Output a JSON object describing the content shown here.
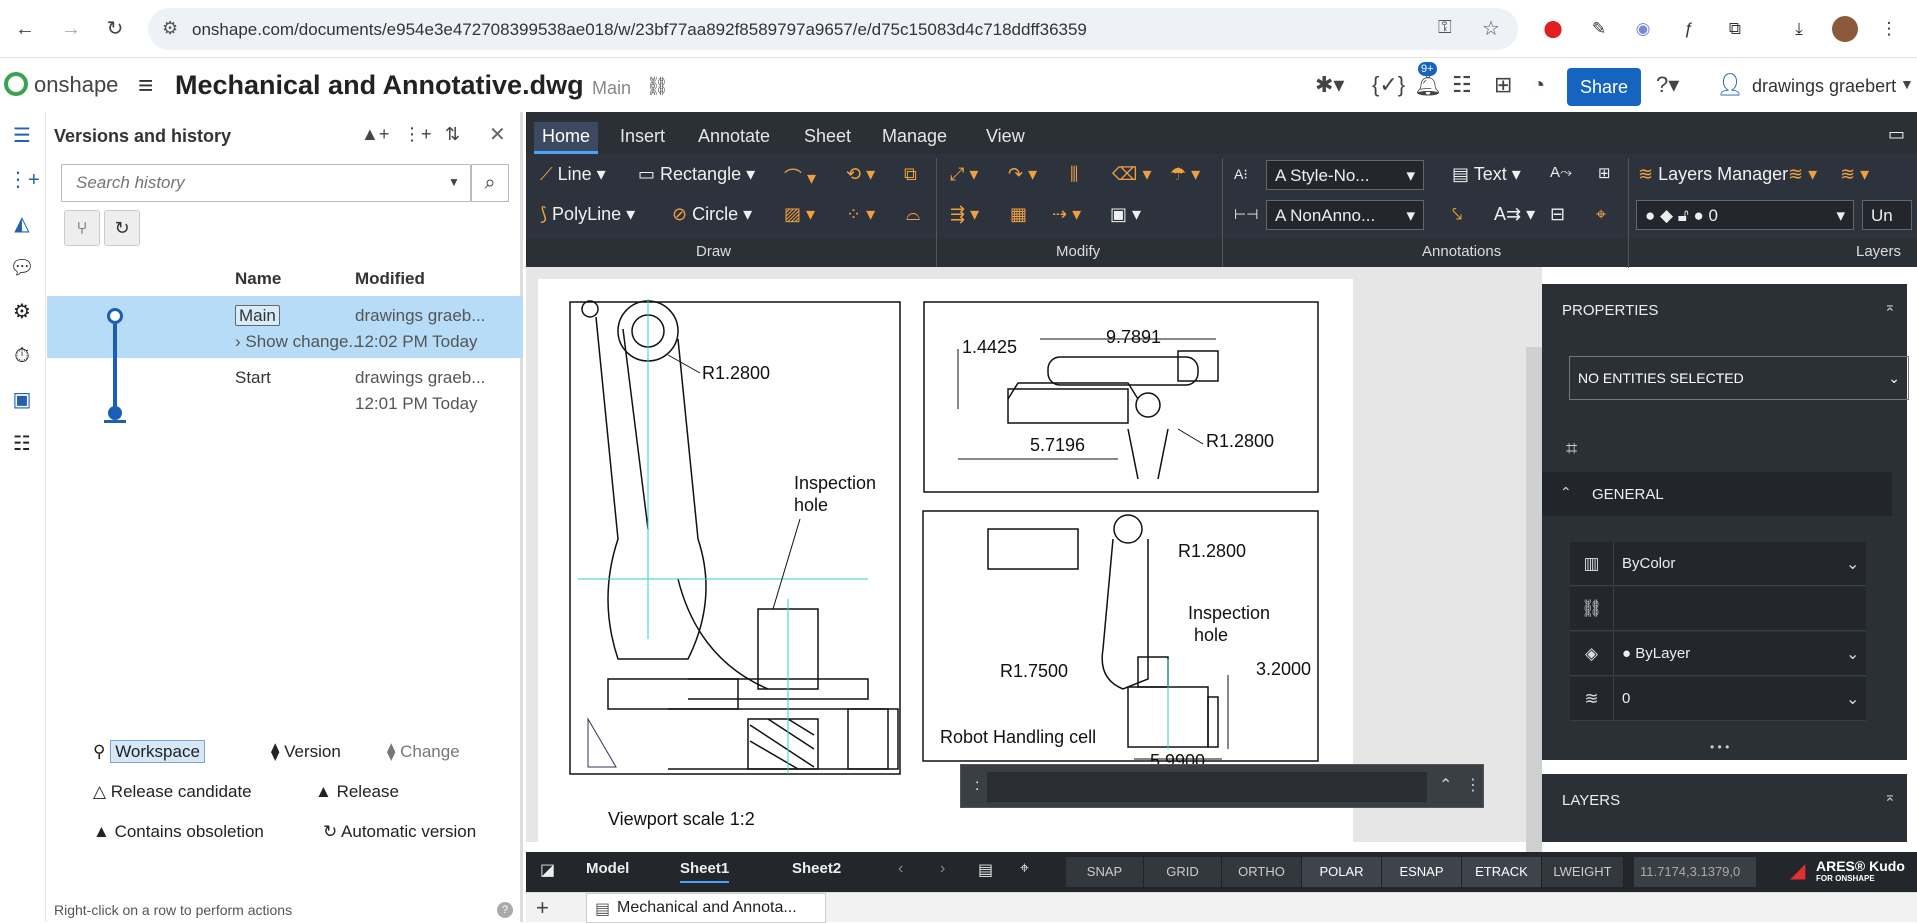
{
  "browser": {
    "url": "onshape.com/documents/e954e3e472708399538ae018/w/23bf77aa892f8589797a9657/e/d75c15083d4c718ddff36359"
  },
  "app": {
    "logo_text": "onshape",
    "doc_title": "Mechanical and Annotative.dwg",
    "branch": "Main",
    "share_label": "Share",
    "notif_badge": "9+",
    "user_name": "drawings graebert"
  },
  "versions": {
    "title": "Versions and history",
    "search_placeholder": "Search history",
    "col_name": "Name",
    "col_modified": "Modified",
    "rows": [
      {
        "name": "Main",
        "sub": "Show change...",
        "modified_by": "drawings graeb...",
        "time": "12:02 PM Today"
      },
      {
        "name": "Start",
        "sub": "",
        "modified_by": "drawings graeb...",
        "time": "12:01 PM Today"
      }
    ],
    "legend": {
      "workspace": "Workspace",
      "version": "Version",
      "change": "Change",
      "release_candidate": "Release candidate",
      "release": "Release",
      "contains_obsoletion": "Contains obsoletion",
      "automatic_version": "Automatic version"
    },
    "footer_hint": "Right-click on a row to perform actions"
  },
  "ribbon": {
    "tabs": [
      "Home",
      "Insert",
      "Annotate",
      "Sheet",
      "Manage",
      "View"
    ],
    "line": "Line",
    "rectangle": "Rectangle",
    "polyline": "PolyLine",
    "circle": "Circle",
    "text_style": "Style-No...",
    "dim_style": "NonAnno...",
    "text": "Text",
    "layers_manager": "Layers Manager",
    "layer_value": "0",
    "unsaved_fragment": "Un",
    "groups": [
      "Draw",
      "Modify",
      "Annotations",
      "Layers"
    ]
  },
  "drawing": {
    "dims": {
      "r1": "R1.2800",
      "d1": "1.4425",
      "d2": "9.7891",
      "d3": "5.7196",
      "r2": "R1.2800",
      "r3": "R1.2800",
      "r4": "R1.7500",
      "d4": "3.2000",
      "d5": "5.9900"
    },
    "inspection_1": "Inspection",
    "hole_1": "hole",
    "inspection_2": "Inspection",
    "hole_2": "hole",
    "cell_label": "Robot Handling cell",
    "viewport_label": "Viewport scale 1:2"
  },
  "cmd": {
    "prompt": ":"
  },
  "properties": {
    "title": "PROPERTIES",
    "selection": "NO ENTITIES SELECTED",
    "section": "GENERAL",
    "color": "ByColor",
    "linetype": "ByLayer",
    "layer": "0"
  },
  "layers": {
    "title": "LAYERS"
  },
  "status": {
    "model": "Model",
    "sheet1": "Sheet1",
    "sheet2": "Sheet2",
    "toggles": [
      "SNAP",
      "GRID",
      "ORTHO",
      "POLAR",
      "ESNAP",
      "ETRACK",
      "LWEIGHT"
    ],
    "coords": "11.7174,3.1379,0",
    "ares": "ARES® Kudo",
    "ares_sub": "FOR ONSHAPE"
  },
  "doc_tab": {
    "label": "Mechanical and Annota..."
  }
}
